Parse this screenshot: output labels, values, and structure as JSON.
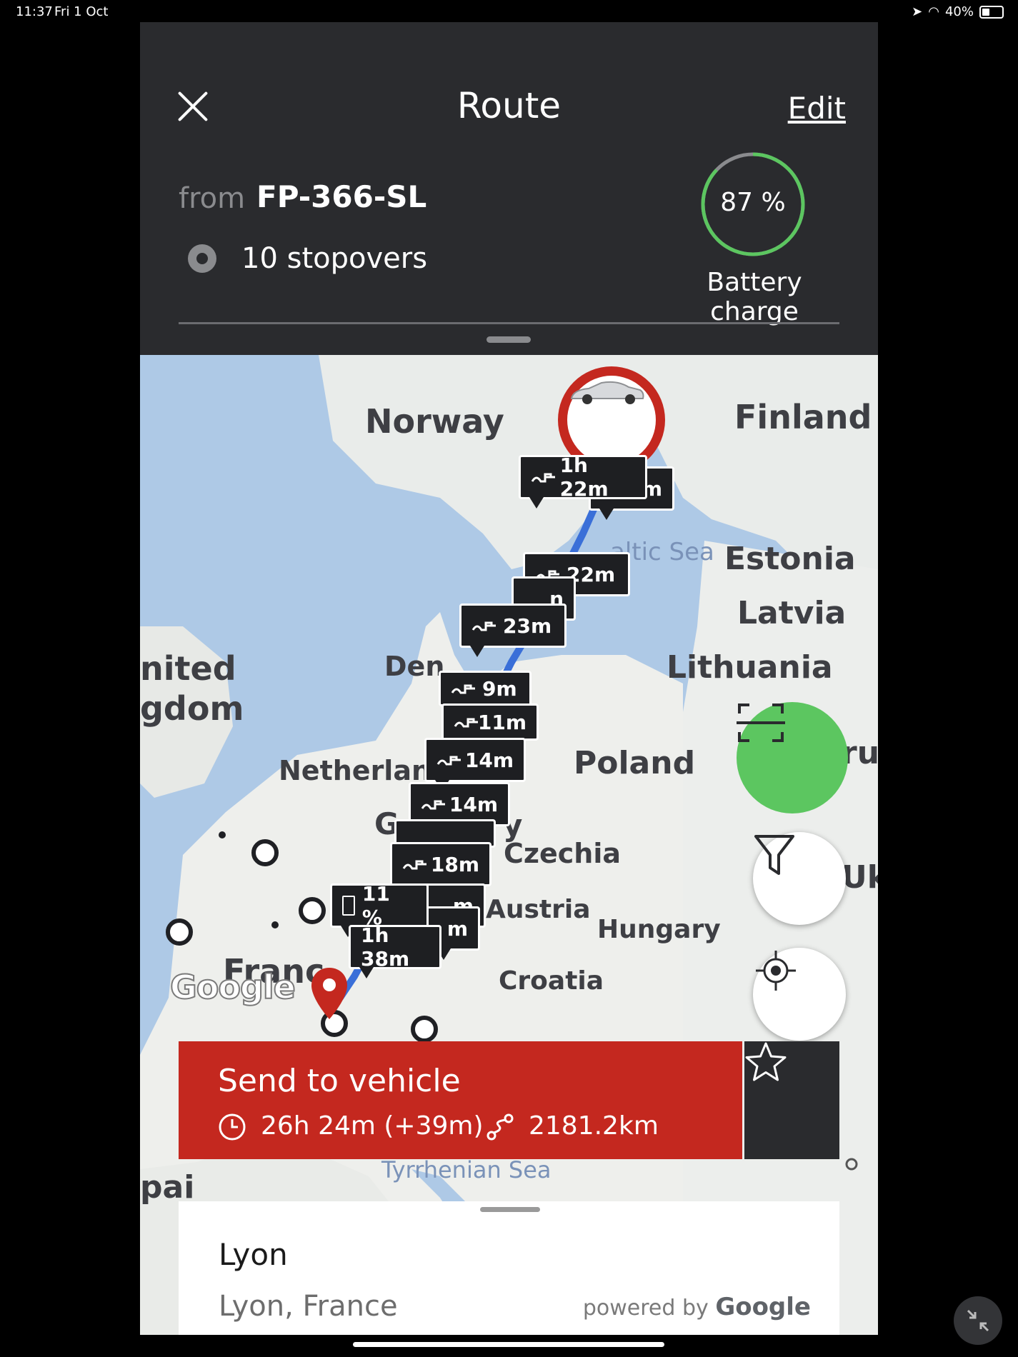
{
  "status_bar": {
    "time": "11:37",
    "date": "Fri 1 Oct",
    "battery": "40%"
  },
  "header": {
    "title": "Route",
    "edit_label": "Edit",
    "from_label": "from",
    "vehicle_plate": "FP-366-SL",
    "stopovers": "10 stopovers",
    "battery_charge_value": "87 %",
    "battery_charge_level": 0.87,
    "battery_charge_label": "Battery charge"
  },
  "map": {
    "countries": {
      "norway": "Norway",
      "finland": "Finland",
      "estonia": "Estonia",
      "latvia": "Latvia",
      "lithuania": "Lithuania",
      "poland": "Poland",
      "czechia": "Czechia",
      "austria": "Austria",
      "hungary": "Hungary",
      "croatia": "Croatia",
      "netherlands": "Netherlan",
      "denmark": "Den",
      "uk_top": "nited",
      "uk_bottom": "gdom",
      "france": "Franc",
      "belarus": "rus",
      "ukraine": "Uk",
      "spain": "pai",
      "germany": "G",
      "germany_end": "y"
    },
    "seas": {
      "baltic": "altic Sea",
      "tyrrhenian": "Tyrrhenian Sea"
    },
    "google_logo": "Google",
    "charge_stops": [
      {
        "label": "1h 22m"
      },
      {
        "label": "m"
      },
      {
        "label": "22m"
      },
      {
        "label": "23m"
      },
      {
        "label": "n"
      },
      {
        "label": "9m"
      },
      {
        "label": "11m"
      },
      {
        "label": "14m"
      },
      {
        "label": "14m"
      },
      {
        "label": "18m"
      },
      {
        "label": "m"
      },
      {
        "label": "m"
      }
    ],
    "arrival_battery": "11 %",
    "arrival_time": "1h 38m",
    "colors": {
      "route_pin": "#c4281f",
      "vehicle_ring": "#c4281f",
      "scan_button": "#5cc660"
    },
    "icons": [
      "car-icon",
      "plug-icon",
      "scan-icon",
      "filter-icon",
      "locate-icon",
      "location-pin-icon"
    ]
  },
  "route_summary": {
    "send_label": "Send to vehicle",
    "duration": "26h 24m (+39m)",
    "distance": "2181.2km"
  },
  "destination": {
    "name": "Lyon",
    "address": "Lyon, France",
    "powered_by": "powered by",
    "powered_brand": "Google"
  }
}
